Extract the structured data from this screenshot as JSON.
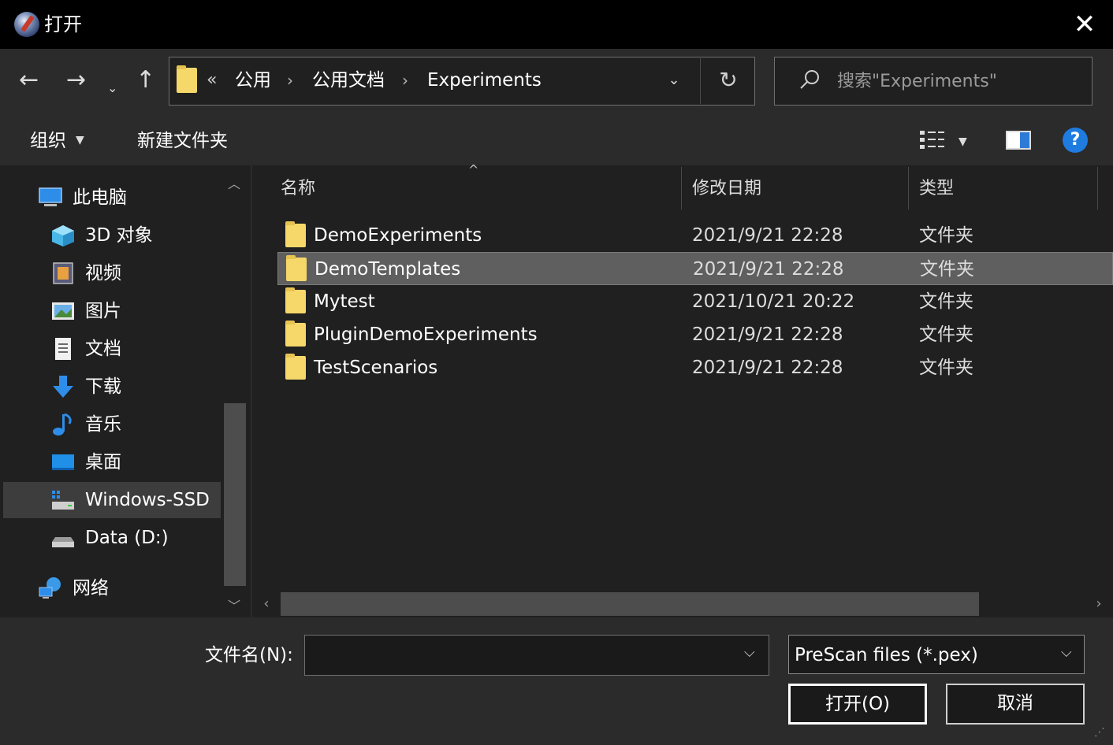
{
  "window": {
    "title": "打开",
    "close_glyph": "✕"
  },
  "nav": {
    "back_glyph": "←",
    "forward_glyph": "→",
    "recent_glyph": "⌄",
    "up_glyph": "↑",
    "overflow_glyph": "«",
    "breadcrumbs": [
      "公用",
      "公用文档",
      "Experiments"
    ],
    "separator_glyph": "›",
    "dropdown_glyph": "⌄",
    "refresh_glyph": "↻",
    "search_placeholder": "搜索\"Experiments\""
  },
  "toolbar": {
    "organize_label": "组织",
    "new_folder_label": "新建文件夹",
    "help_glyph": "?"
  },
  "sidebar": {
    "items": [
      {
        "label": "此电脑",
        "icon": "computer-icon"
      },
      {
        "label": "3D 对象",
        "icon": "cube-3d-icon"
      },
      {
        "label": "视频",
        "icon": "video-icon"
      },
      {
        "label": "图片",
        "icon": "picture-icon"
      },
      {
        "label": "文档",
        "icon": "document-icon"
      },
      {
        "label": "下载",
        "icon": "download-icon"
      },
      {
        "label": "音乐",
        "icon": "music-icon"
      },
      {
        "label": "桌面",
        "icon": "desktop-icon"
      },
      {
        "label": "Windows-SSD",
        "icon": "drive-icon"
      },
      {
        "label": "Data (D:)",
        "icon": "drive-icon"
      },
      {
        "label": "网络",
        "icon": "network-icon"
      }
    ]
  },
  "columns": {
    "name": "名称",
    "date": "修改日期",
    "type": "类型"
  },
  "files": [
    {
      "name": "DemoExperiments",
      "date": "2021/9/21 22:28",
      "type": "文件夹"
    },
    {
      "name": "DemoTemplates",
      "date": "2021/9/21 22:28",
      "type": "文件夹"
    },
    {
      "name": "Mytest",
      "date": "2021/10/21 20:22",
      "type": "文件夹"
    },
    {
      "name": "PluginDemoExperiments",
      "date": "2021/9/21 22:28",
      "type": "文件夹"
    },
    {
      "name": "TestScenarios",
      "date": "2021/9/21 22:28",
      "type": "文件夹"
    }
  ],
  "bottom": {
    "filename_label": "文件名(N):",
    "filename_value": "",
    "filter_value": "PreScan files (*.pex)",
    "open_label": "打开(O)",
    "cancel_label": "取消"
  },
  "colors": {
    "titlebar": "#000000",
    "background": "#2b2b2b",
    "pane": "#202020",
    "folder": "#f5d76a",
    "selection": "#5f5f5f",
    "accent": "#1e7be0"
  }
}
